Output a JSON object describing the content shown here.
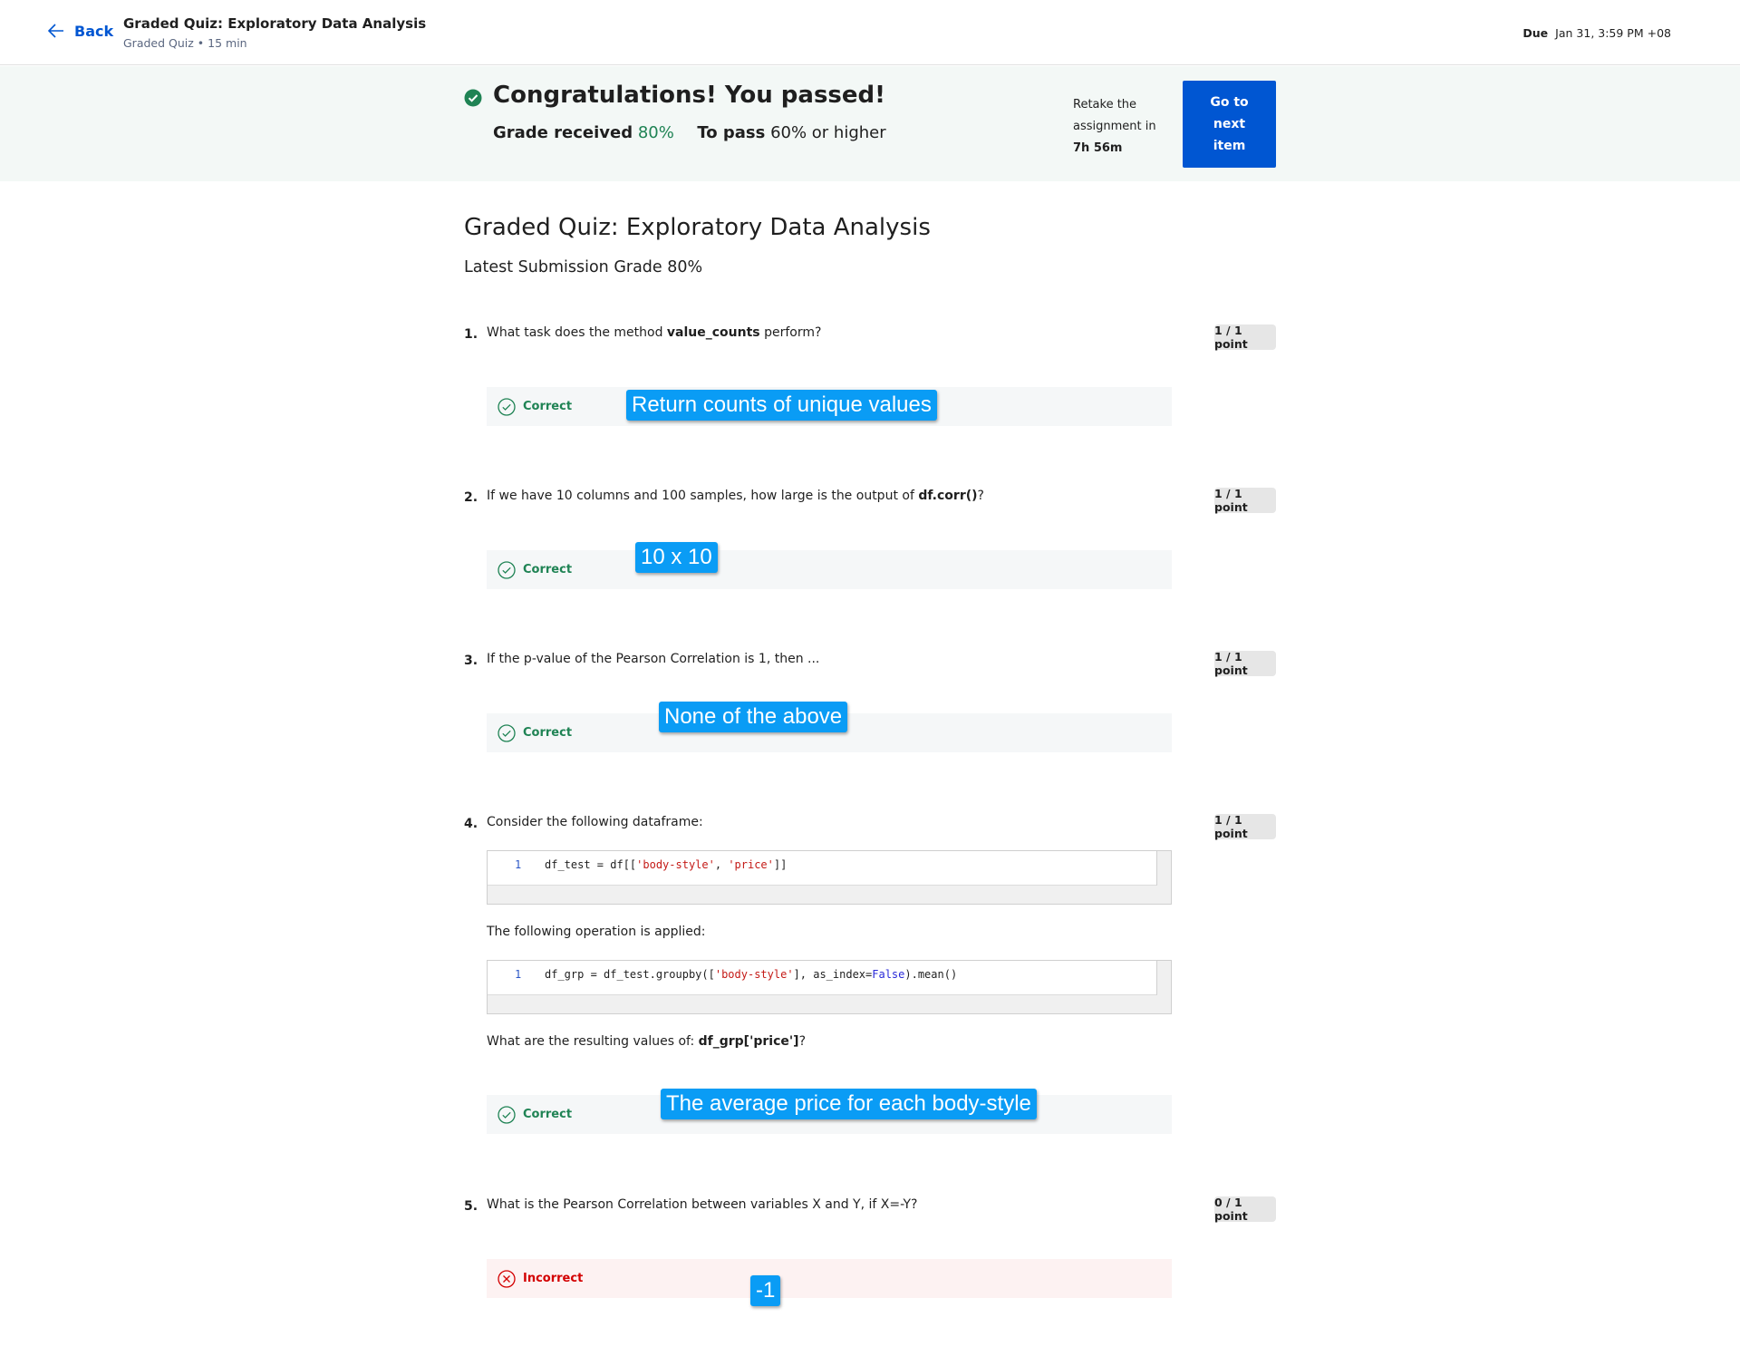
{
  "header": {
    "back_label": "Back",
    "title": "Graded Quiz: Exploratory Data Analysis",
    "subtitle": "Graded Quiz • 15 min",
    "due_label": "Due",
    "due_value": "Jan 31, 3:59 PM +08"
  },
  "banner": {
    "title": "Congratulations! You passed!",
    "grade_label": "Grade received",
    "grade_value": "80%",
    "pass_label": "To pass",
    "pass_value": "60% or higher",
    "retake_prefix": "Retake the assignment in",
    "retake_time": "7h 56m",
    "next_button": "Go to next item",
    "accent_color": "#1f8354",
    "button_color": "#0056d2"
  },
  "main": {
    "title": "Graded Quiz: Exploratory Data Analysis",
    "latest_grade": "Latest Submission Grade 80%"
  },
  "questions": [
    {
      "number": "1.",
      "text_before": "What task does the method ",
      "text_bold": "value_counts",
      "text_after": " perform?",
      "points": "1 / 1 point",
      "result": "Correct",
      "answer_tag": "Return counts of unique values"
    },
    {
      "number": "2.",
      "text_before": "If we have 10 columns and 100 samples, how large is the output of ",
      "text_bold": "df.corr()",
      "text_after": "?",
      "points": "1 / 1 point",
      "result": "Correct",
      "answer_tag": "10 x 10"
    },
    {
      "number": "3.",
      "text": "If the p-value of the Pearson Correlation is 1, then ...",
      "points": "1 / 1 point",
      "result": "Correct",
      "answer_tag": "None of the above"
    },
    {
      "number": "4.",
      "text": "Consider the following dataframe:",
      "code1": {
        "line_no": "1",
        "a": "df_test = df[[",
        "s1": "'body-style'",
        "b": ", ",
        "s2": "'price'",
        "c": "]]"
      },
      "para2": "The following operation is applied:",
      "code2": {
        "line_no": "1",
        "a": "df_grp = df_test.groupby([",
        "s1": "'body-style'",
        "b": "], as_index=",
        "kw": "False",
        "c": ").mean()"
      },
      "para3_before": "What are the resulting values of: ",
      "para3_bold": "df_grp['price']",
      "para3_after": "?",
      "points": "1 / 1 point",
      "result": "Correct",
      "answer_tag": "The average price for each body-style"
    },
    {
      "number": "5.",
      "text": "What is the Pearson Correlation between variables X and Y, if X=-Y?",
      "points": "0 / 1 point",
      "result": "Incorrect",
      "answer_tag": "-1"
    }
  ]
}
